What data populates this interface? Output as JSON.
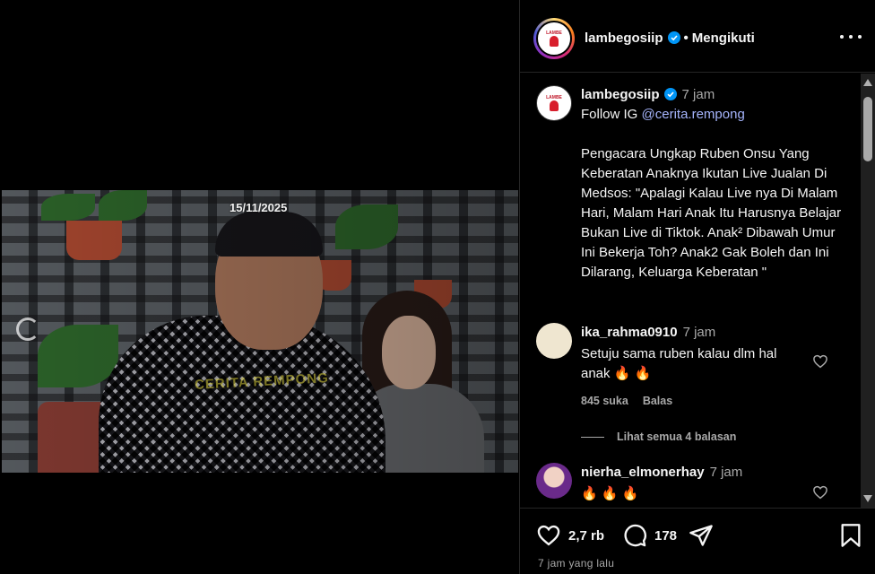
{
  "video": {
    "date_overlay": "15/11/2025",
    "watermark": "CERITA REMPONG"
  },
  "header": {
    "username": "lambegosiip",
    "verified": true,
    "separator": "•",
    "follow_state": "Mengikuti",
    "more_icon": "more-horizontal-icon"
  },
  "caption": {
    "username": "lambegosiip",
    "time": "7 jam",
    "follow_prefix": "Follow IG ",
    "follow_handle": "@cerita.rempong",
    "body": "Pengacara Ungkap Ruben Onsu Yang Keberatan Anaknya Ikutan Live Jualan Di Medsos: \"Apalagi Kalau Live nya Di Malam Hari, Malam Hari Anak Itu Harusnya Belajar Bukan Live di Tiktok. Anak² Dibawah Umur Ini Bekerja Toh? Anak2 Gak Boleh dan Ini Dilarang, Keluarga Keberatan \""
  },
  "comments": [
    {
      "username": "ika_rahma0910",
      "time": "7 jam",
      "text": "Setuju sama ruben kalau dlm hal anak 🔥 🔥",
      "likes": "845 suka",
      "reply": "Balas",
      "view_replies": "Lihat semua 4 balasan"
    },
    {
      "username": "nierha_elmonerhay",
      "time": "7 jam",
      "text": "🔥 🔥 🔥"
    }
  ],
  "actions": {
    "likes_count": "2,7 rb",
    "comments_count": "178",
    "timestamp": "7 jam yang lalu"
  },
  "colors": {
    "background": "#000000",
    "text": "#f5f5f5",
    "muted": "#a8a8a8",
    "link": "#a5b4fc",
    "verified": "#0095f6"
  }
}
